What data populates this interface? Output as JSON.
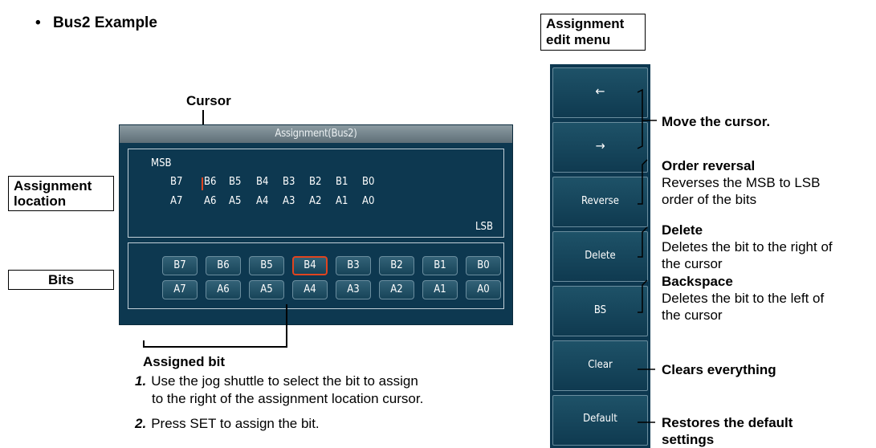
{
  "heading": {
    "bullet": "•",
    "text": "Bus2 Example"
  },
  "callouts": {
    "cursor": "Cursor",
    "assignment_location": [
      "Assignment",
      "location"
    ],
    "bits": "Bits",
    "assigned_bit": "Assigned bit",
    "menu_header": [
      "Assignment",
      "edit menu"
    ]
  },
  "panel": {
    "title": "Assignment(Bus2)",
    "msb": "MSB",
    "lsb": "LSB",
    "loc_row_b": [
      "B7",
      "B6",
      "B5",
      "B4",
      "B3",
      "B2",
      "B1",
      "B0"
    ],
    "loc_row_a": [
      "A7",
      "A6",
      "A5",
      "A4",
      "A3",
      "A2",
      "A1",
      "A0"
    ],
    "bits_row_b": [
      "B7",
      "B6",
      "B5",
      "B4",
      "B3",
      "B2",
      "B1",
      "B0"
    ],
    "bits_row_a": [
      "A7",
      "A6",
      "A5",
      "A4",
      "A3",
      "A2",
      "A1",
      "A0"
    ],
    "selected_bit": "B4"
  },
  "steps": [
    {
      "num": "1.",
      "lines": [
        "Use the jog shuttle to select the bit to assign",
        "to the right of the assignment location cursor."
      ]
    },
    {
      "num": "2.",
      "lines": [
        "Press SET to assign the bit."
      ]
    }
  ],
  "menu": {
    "buttons": [
      {
        "label": "←",
        "icon": "left-arrow-icon"
      },
      {
        "label": "→",
        "icon": "right-arrow-icon"
      },
      {
        "label": "Reverse"
      },
      {
        "label": "Delete"
      },
      {
        "label": "BS"
      },
      {
        "label": "Clear"
      },
      {
        "label": "Default"
      }
    ]
  },
  "descriptions": {
    "move": "Move the cursor.",
    "reverse": {
      "title": "Order reversal",
      "lines": [
        "Reverses the MSB to LSB",
        "order of the bits"
      ]
    },
    "delete": {
      "title": "Delete",
      "lines": [
        "Deletes the bit to the right of",
        "the cursor"
      ]
    },
    "bs": {
      "title": "Backspace",
      "lines": [
        "Deletes the bit to the left of",
        "the cursor"
      ]
    },
    "clear": {
      "title": "Clears everything"
    },
    "default": {
      "title": [
        "Restores the default",
        "settings"
      ]
    }
  },
  "colors": {
    "panel_bg": "#0d3850",
    "cursor": "#e0441f",
    "button_border": "#6a8d9e"
  }
}
